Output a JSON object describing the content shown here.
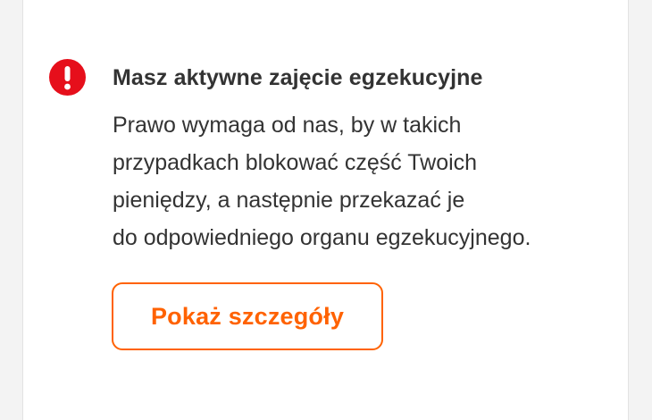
{
  "alert": {
    "icon": "exclamation-icon",
    "icon_color": "#e60f1b",
    "title": "Masz aktywne zajęcie egzekucyjne",
    "body_lines": [
      "Prawo wymaga od nas, by w takich",
      "przypadkach blokować część Twoich",
      "pieniędzy, a następnie przekazać je",
      "do odpowiedniego organu egzekucyjnego."
    ],
    "button_label": "Pokaż szczegóły",
    "accent_color": "#ff6200"
  }
}
